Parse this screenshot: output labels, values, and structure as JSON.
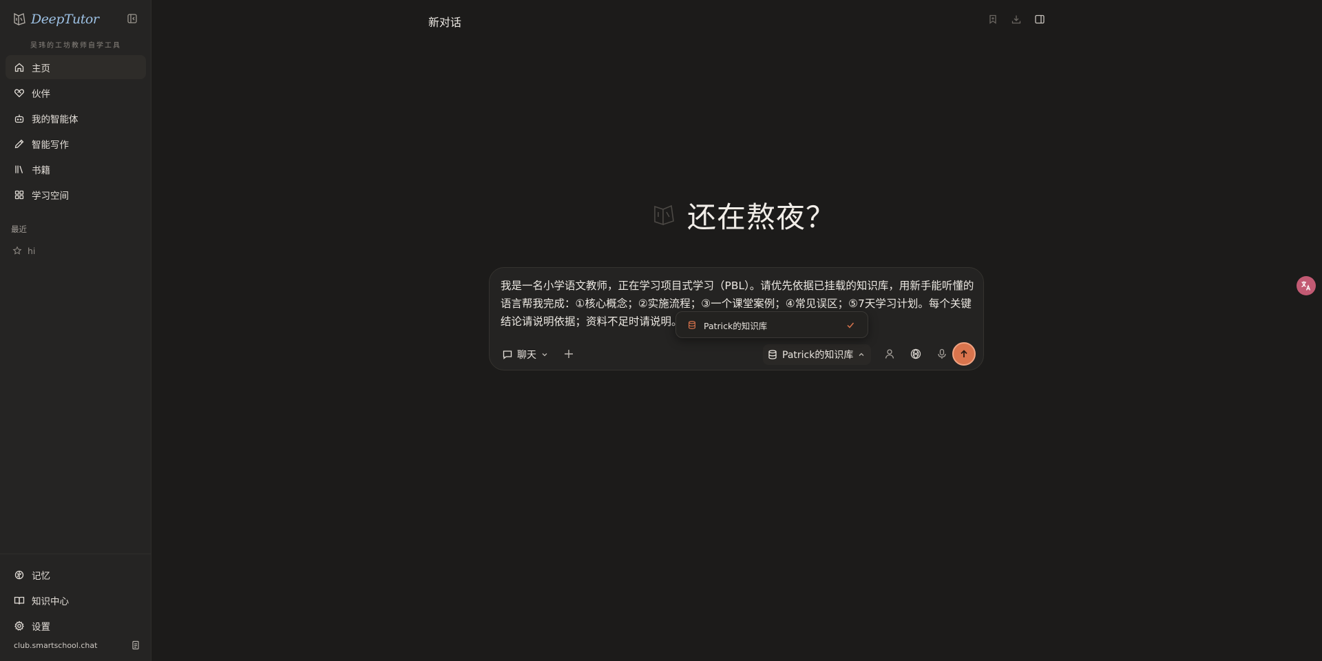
{
  "brand": {
    "name": "DeepTutor",
    "tagline": "吴玮的工坊教师自学工具"
  },
  "sidebar": {
    "nav": [
      {
        "label": "主页",
        "icon": "home-icon",
        "active": true
      },
      {
        "label": "伙伴",
        "icon": "heart-handshake-icon"
      },
      {
        "label": "我的智能体",
        "icon": "bot-icon"
      },
      {
        "label": "智能写作",
        "icon": "pen-icon"
      },
      {
        "label": "书籍",
        "icon": "library-icon"
      },
      {
        "label": "学习空间",
        "icon": "grid-icon"
      }
    ],
    "recent_title": "最近",
    "recent": [
      {
        "label": "hi",
        "icon": "star-icon"
      }
    ],
    "bottom": [
      {
        "label": "记忆",
        "icon": "brain-icon"
      },
      {
        "label": "知识中心",
        "icon": "book-open-icon"
      },
      {
        "label": "设置",
        "icon": "gear-icon"
      }
    ],
    "footer_domain": "club.smartschool.chat"
  },
  "header": {
    "title": "新对话"
  },
  "greeting": "还在熬夜？",
  "composer": {
    "text": "我是一名小学语文教师，正在学习项目式学习（PBL）。请优先依据已挂载的知识库，用新手能听懂的语言帮我完成：①核心概念；②实施流程；③一个课堂案例；④常见误区；⑤7天学习计划。每个关键结论请说明依据；资料不足时请说明。",
    "mode_label": "聊天",
    "kb_label": "Patrick的知识库"
  },
  "dropdown": {
    "options": [
      {
        "label": "Patrick的知识库",
        "selected": true
      }
    ]
  },
  "colors": {
    "accent": "#d9744d",
    "brand_blue": "#9dc1e4",
    "background": "#1c1b1a",
    "sidebar": "#252423"
  }
}
